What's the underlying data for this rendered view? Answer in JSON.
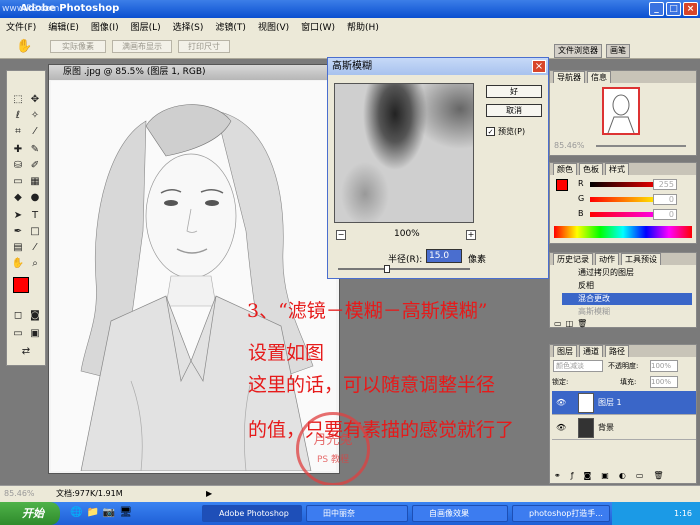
{
  "app": {
    "title": "Adobe Photoshop",
    "watermark": "www.PS.com"
  },
  "menu": [
    "文件(F)",
    "编辑(E)",
    "图像(I)",
    "图层(L)",
    "选择(S)",
    "滤镜(T)",
    "视图(V)",
    "窗口(W)",
    "帮助(H)"
  ],
  "options": {
    "btn1": "实际像素",
    "btn2": "满画布显示",
    "btn3": "打印尺寸",
    "tab1": "文件浏览器",
    "tab2": "画笔"
  },
  "document": {
    "title": "原图  .jpg @ 85.5% (图层 1, RGB)"
  },
  "gauss": {
    "title": "高斯模糊",
    "ok": "好",
    "cancel": "取消",
    "preview_label": "预览(P)",
    "zoom": "100%",
    "radius_label": "半径(R):",
    "radius_value": "15.0",
    "unit": "像素"
  },
  "navigator": {
    "tab1": "导航器",
    "tab2": "信息",
    "zoom": "85.46%"
  },
  "color": {
    "tab1": "颜色",
    "tab2": "色板",
    "tab3": "样式",
    "r_label": "R",
    "g_label": "G",
    "b_label": "B",
    "r": "255",
    "g": "0",
    "b": "0"
  },
  "history": {
    "tab1": "历史记录",
    "tab2": "动作",
    "tab3": "工具预设",
    "items": [
      "通过拷贝的图层",
      "反相",
      "混合更改",
      "高斯模糊"
    ]
  },
  "layers": {
    "tab1": "图层",
    "tab2": "通道",
    "tab3": "路径",
    "mode": "颜色减淡",
    "opacity_label": "不透明度:",
    "opacity": "100%",
    "lock_label": "锁定:",
    "fill_label": "填充:",
    "fill": "100%",
    "layer1": "图层 1",
    "background": "背景"
  },
  "annotation": {
    "line1": "3、“滤镜－模糊－高斯模糊”",
    "line2": "设置如图",
    "line3": "这里的话，可以随意调整半径",
    "line4": "的值，只要有素描的感觉就行了"
  },
  "stamp": {
    "text": "月光兔",
    "sub": "PS 教程"
  },
  "status": {
    "zoom": "85.46%",
    "doc": "文档:977K/1.91M"
  },
  "taskbar": {
    "start": "开始",
    "t1": "Adobe Photoshop",
    "t2": "田中丽奈",
    "t3": "自画像效果",
    "t4": "photoshop打造手...",
    "time": "1:16"
  },
  "colors": {
    "accent": "#e61a1a",
    "xpblue": "#1f5fd6"
  }
}
